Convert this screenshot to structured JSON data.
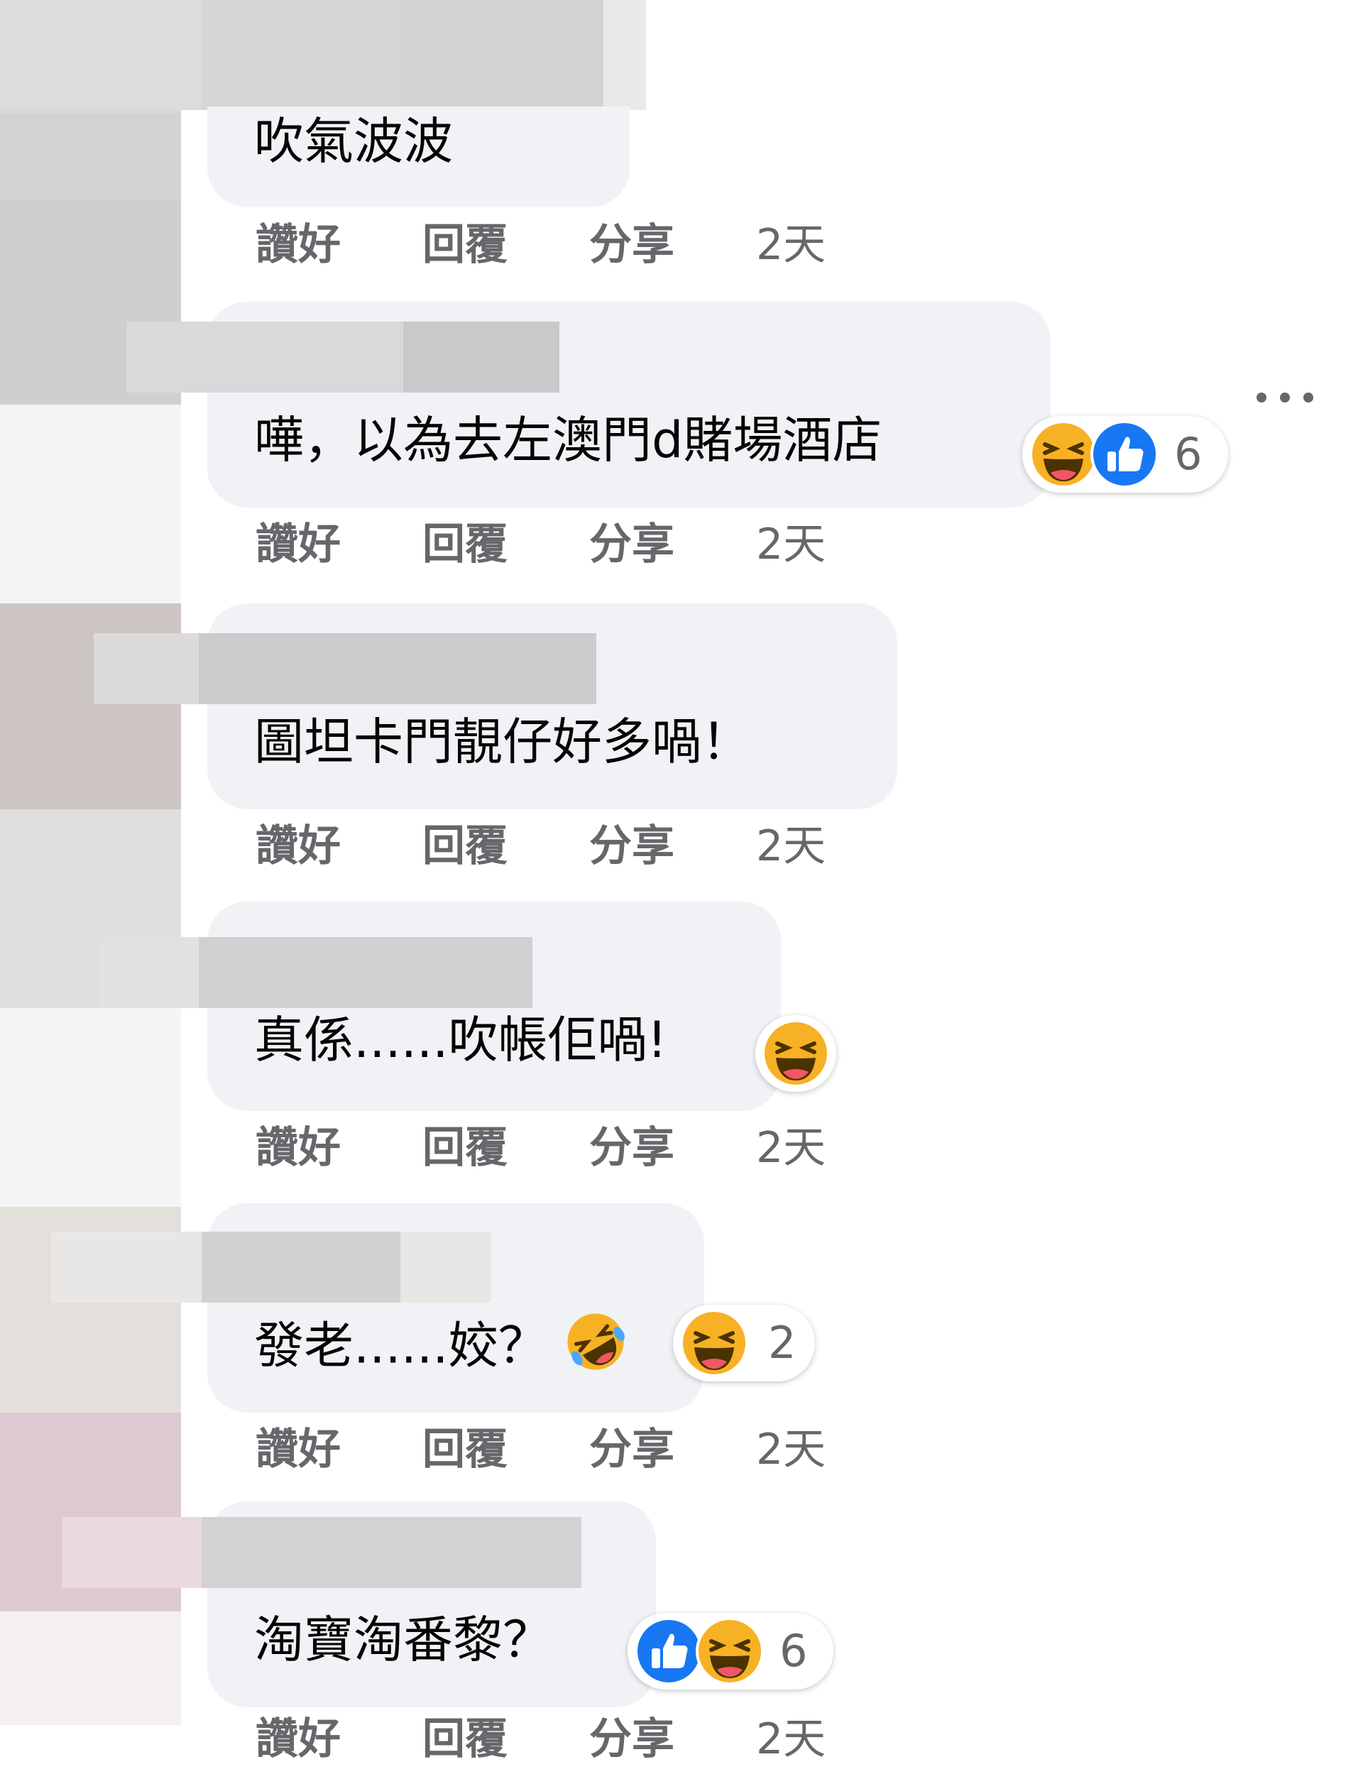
{
  "colors": {
    "bubble_bg": "#f0f2f5",
    "action_text": "#65676b",
    "like_blue": "#1877f2",
    "haha_yellow": "#f7b125"
  },
  "comments": [
    {
      "text": "吹氣波波",
      "actions": {
        "like": "讚好",
        "reply": "回覆",
        "share": "分享",
        "time": "2天"
      }
    },
    {
      "text": "嘩，以為去左澳門d賭場酒店",
      "reactions": {
        "icons": [
          "haha-icon",
          "like-icon"
        ],
        "count": "6"
      },
      "actions": {
        "like": "讚好",
        "reply": "回覆",
        "share": "分享",
        "time": "2天"
      }
    },
    {
      "text": "圖坦卡門靚仔好多喎！",
      "actions": {
        "like": "讚好",
        "reply": "回覆",
        "share": "分享",
        "time": "2天"
      }
    },
    {
      "text": "真係......吹帳佢喎!",
      "reactions": {
        "icons": [
          "haha-icon"
        ],
        "count": ""
      },
      "actions": {
        "like": "讚好",
        "reply": "回覆",
        "share": "分享",
        "time": "2天"
      }
    },
    {
      "text": "發老......姣？",
      "inline_emoji": "rolling-on-floor-laughing-emoji",
      "reactions": {
        "icons": [
          "haha-icon"
        ],
        "count": "2"
      },
      "actions": {
        "like": "讚好",
        "reply": "回覆",
        "share": "分享",
        "time": "2天"
      }
    },
    {
      "text": "淘寶淘番黎？",
      "reactions": {
        "icons": [
          "like-icon",
          "haha-icon"
        ],
        "count": "6"
      },
      "actions": {
        "like": "讚好",
        "reply": "回覆",
        "share": "分享",
        "time": "2天"
      }
    }
  ],
  "more_menu_icon": "more-horizontal-icon"
}
